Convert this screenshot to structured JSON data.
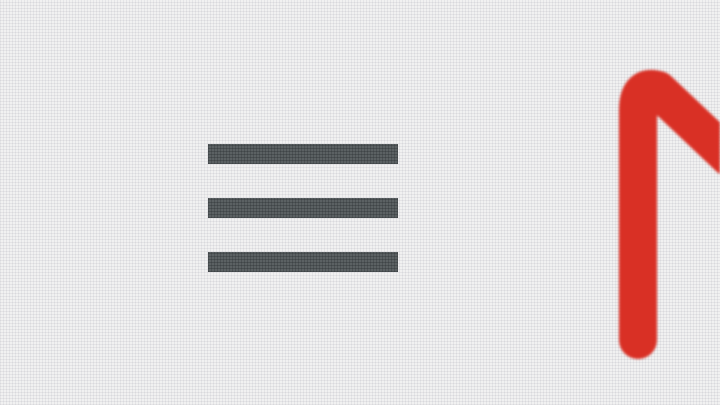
{
  "header": {
    "menu_button": {
      "icon": "hamburger-menu-icon",
      "color": "#5b6163"
    },
    "logo": {
      "icon": "gmail-m-logo",
      "color": "#d93025"
    }
  }
}
